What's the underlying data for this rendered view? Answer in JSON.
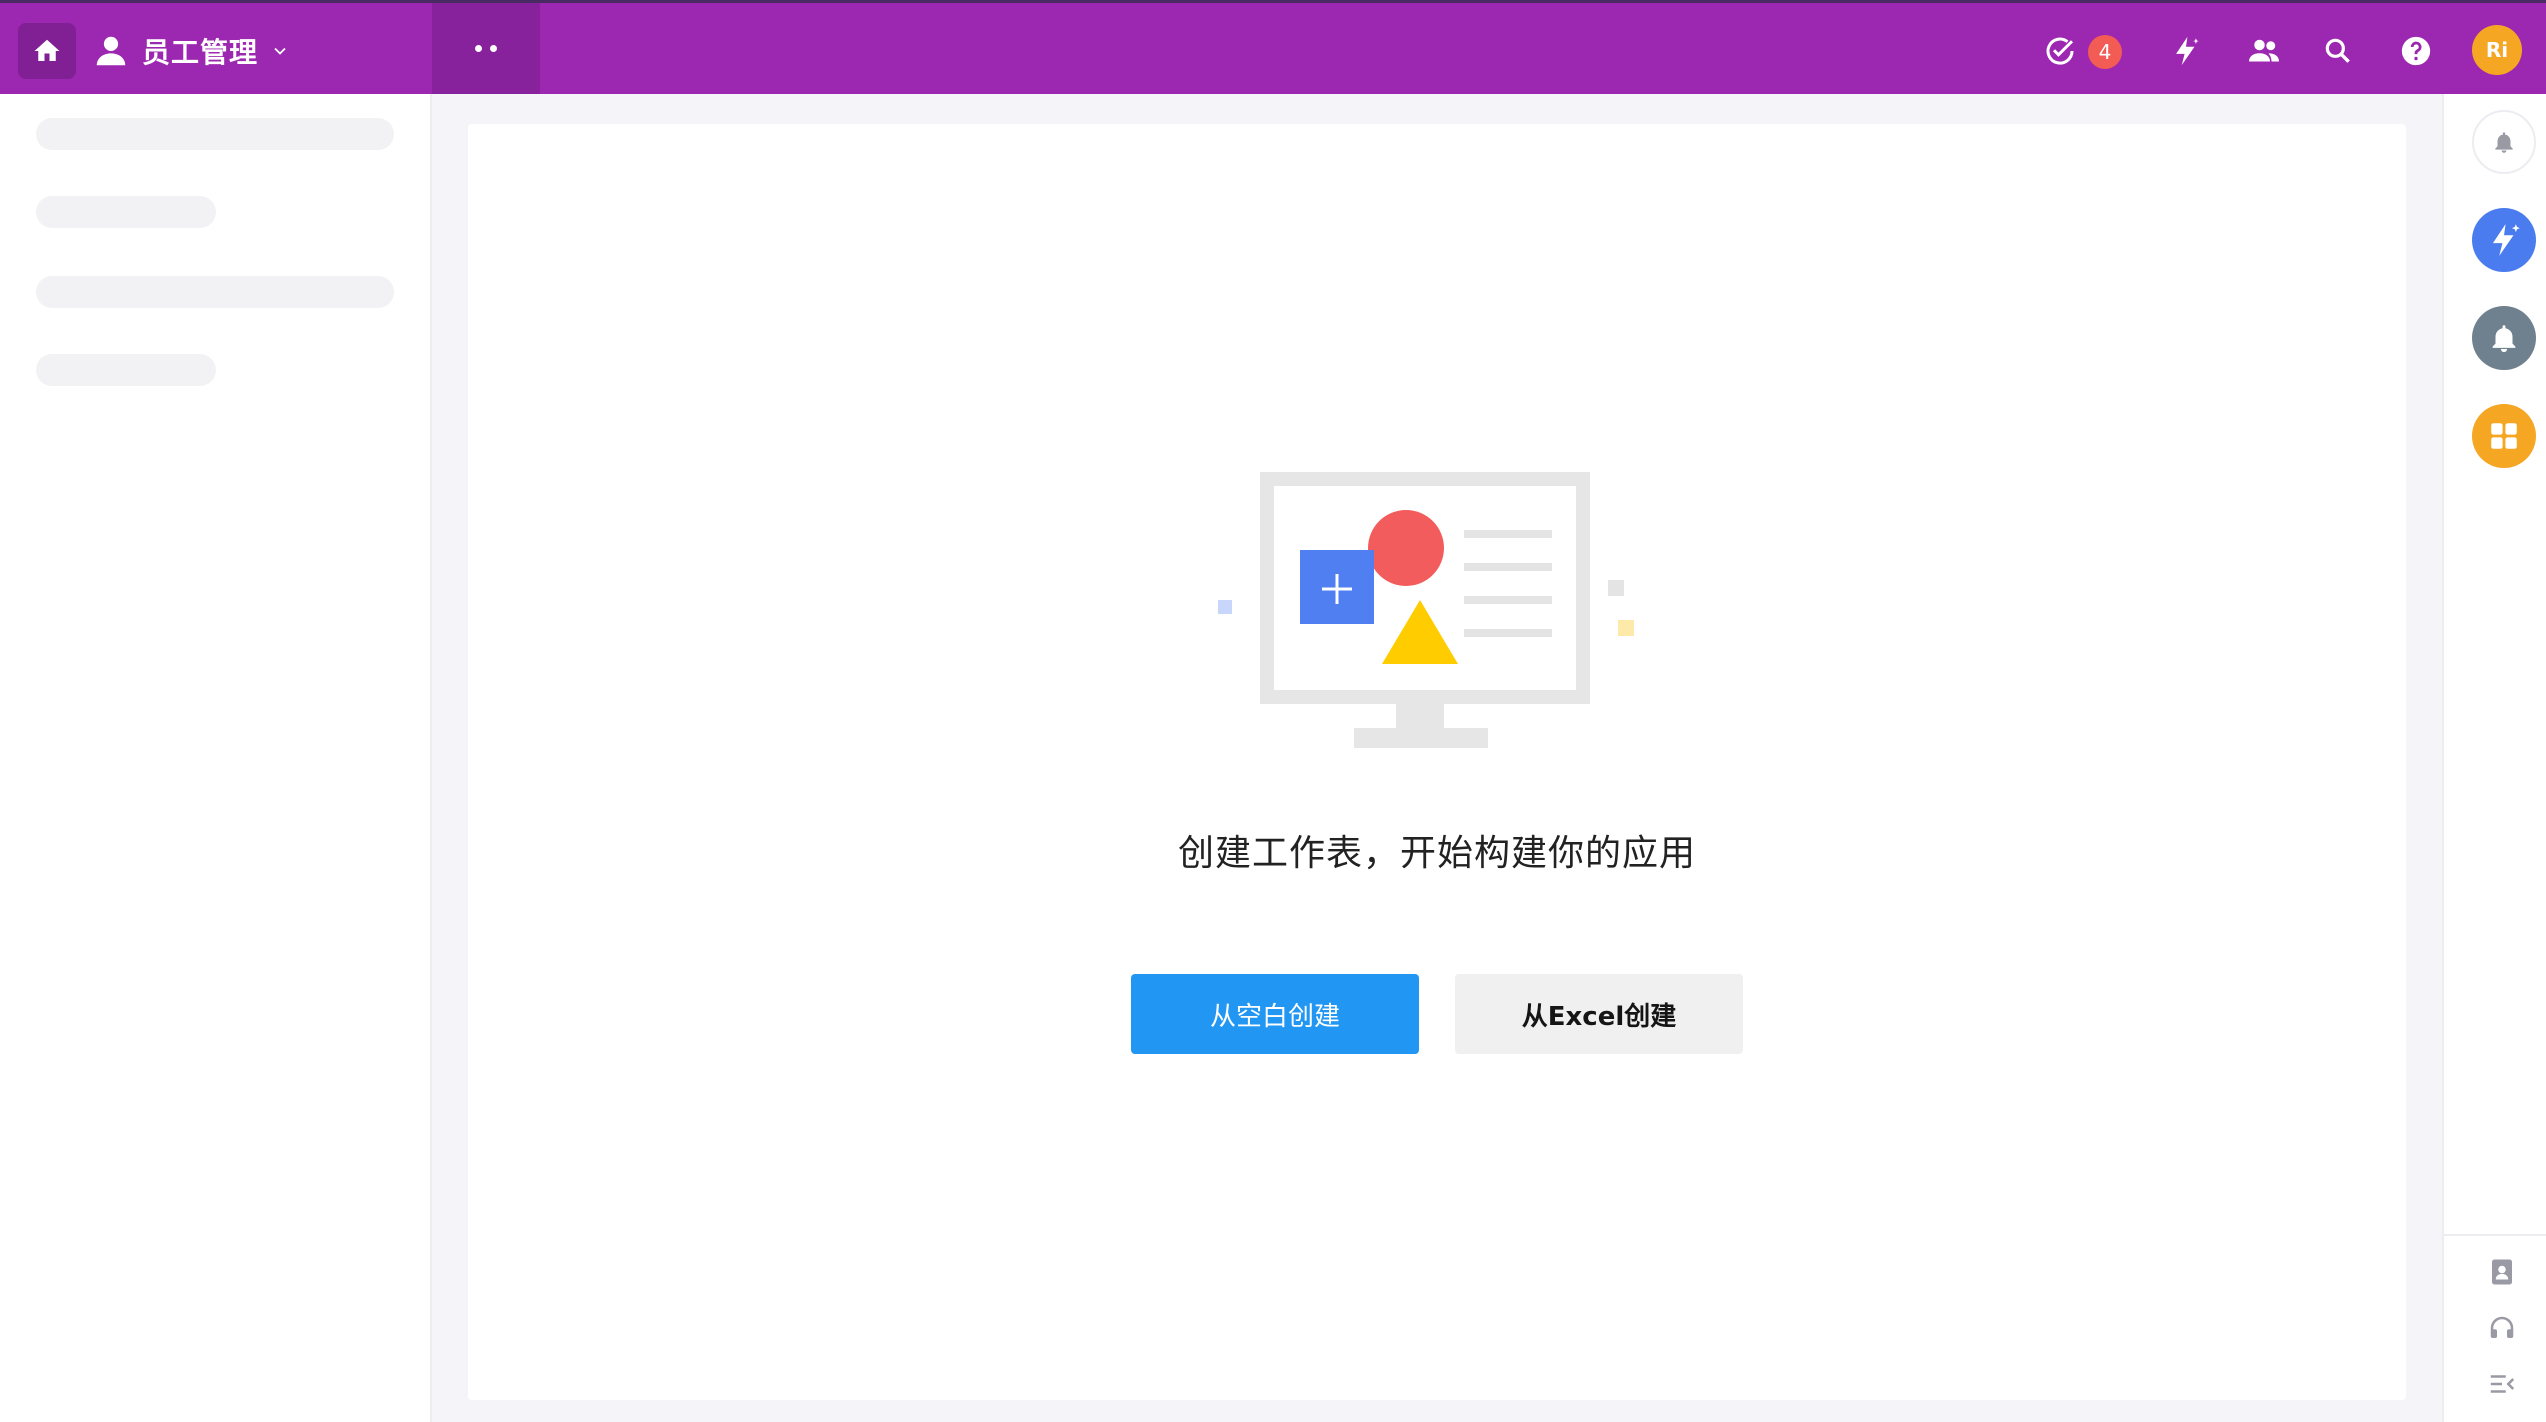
{
  "header": {
    "app_name": "员工管理",
    "todo_count": "4",
    "avatar_initials": "Ri",
    "icons": [
      "home-icon",
      "user-icon",
      "chevron-down-icon",
      "more-icon",
      "check-circle-icon",
      "lightning-icon",
      "people-icon",
      "search-icon",
      "help-icon"
    ]
  },
  "main": {
    "empty_message": "创建工作表，开始构建你的应用",
    "create_blank_label": "从空白创建",
    "create_excel_label": "从Excel创建"
  },
  "right_rail": {
    "icons": [
      "bell-icon",
      "ai-lightning-icon",
      "notification-icon",
      "apps-grid-icon",
      "contacts-icon",
      "headset-icon",
      "collapse-icon"
    ]
  },
  "colors": {
    "brand": "#9c27b0",
    "primary_button": "#2196f3",
    "badge": "#f25c54",
    "avatar": "#f5a623"
  }
}
